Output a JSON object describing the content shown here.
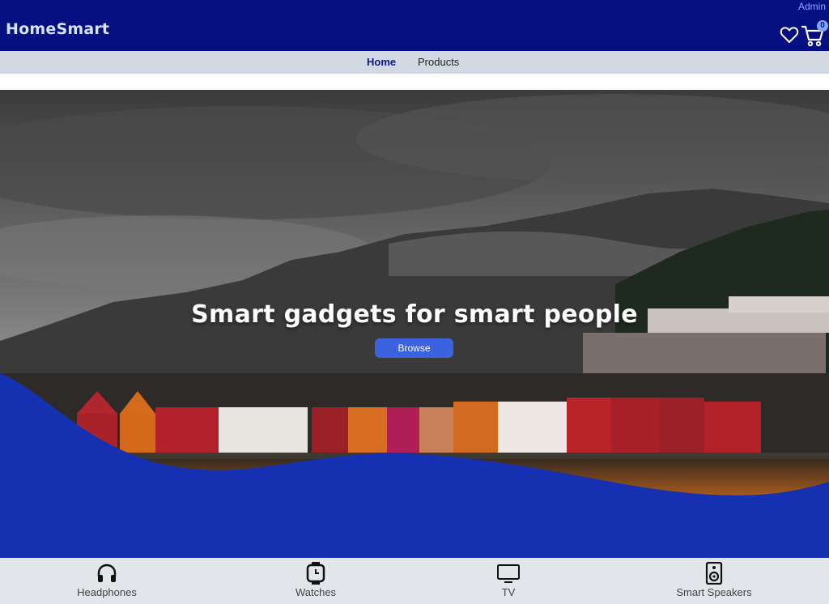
{
  "header": {
    "admin_label": "Admin",
    "brand": "HomeSmart",
    "wishlist_icon": "heart-icon",
    "cart_icon": "cart-icon",
    "cart_count": "0"
  },
  "nav": {
    "items": [
      {
        "label": "Home",
        "active": true
      },
      {
        "label": "Products",
        "active": false
      }
    ]
  },
  "hero": {
    "title": "Smart gadgets for smart people",
    "button_label": "Browse"
  },
  "categories": [
    {
      "label": "Headphones",
      "icon": "headphones-icon"
    },
    {
      "label": "Watches",
      "icon": "watch-icon"
    },
    {
      "label": "TV",
      "icon": "tv-icon"
    },
    {
      "label": "Smart Speakers",
      "icon": "speaker-icon"
    }
  ],
  "colors": {
    "header_bg": "#050f80",
    "nav_bg": "#d3d9e2",
    "wave": "#1530b0",
    "button": "#3b63e0",
    "category_bar": "#e2e5ea"
  }
}
